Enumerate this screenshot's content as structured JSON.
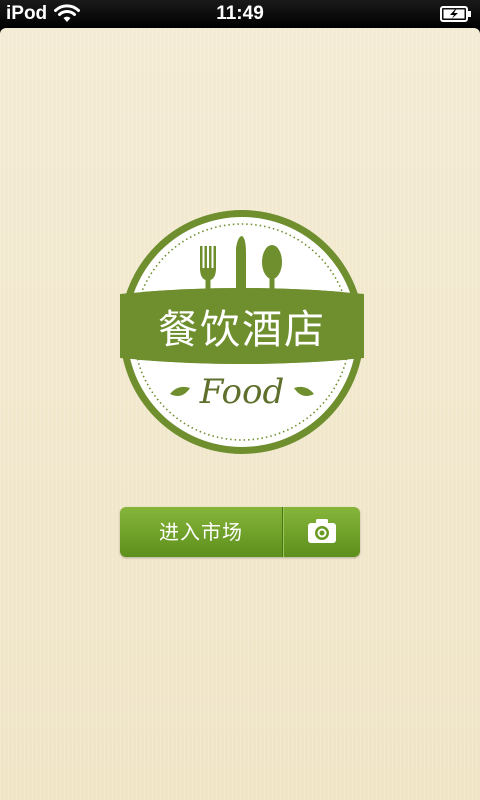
{
  "status_bar": {
    "carrier": "iPod",
    "time": "11:49",
    "wifi_icon": "wifi-icon",
    "battery_icon": "battery-charging-icon"
  },
  "logo": {
    "title": "餐饮酒店",
    "subtitle": "Food",
    "icons": [
      "fork-icon",
      "knife-icon",
      "spoon-icon",
      "leaf-icon"
    ],
    "colors": {
      "primary": "#6f8f2f",
      "ring_background": "#ffffff"
    }
  },
  "actions": {
    "enter_label": "进入市场",
    "camera_icon": "camera-icon",
    "button_color": "#6f9f27"
  },
  "theme": {
    "background": "#f1e8cf"
  }
}
